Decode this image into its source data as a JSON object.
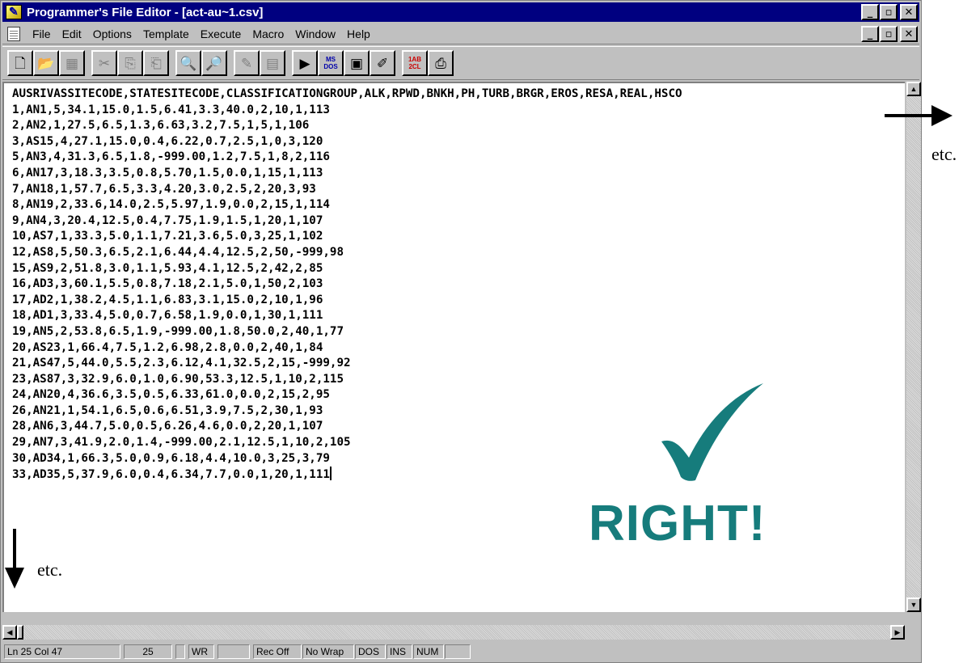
{
  "window": {
    "title": "Programmer's File Editor - [act-au~1.csv]",
    "min_glyph": "_",
    "max_glyph": "▫",
    "close_glyph": "✕"
  },
  "menu": {
    "items": [
      "File",
      "Edit",
      "Options",
      "Template",
      "Execute",
      "Macro",
      "Window",
      "Help"
    ],
    "underlined": [
      "F",
      "E",
      "O",
      "T",
      "x",
      "M",
      "W",
      "H"
    ]
  },
  "toolbar": {
    "buttons": [
      {
        "name": "new-file-icon",
        "glyph": "🗋",
        "enabled": true
      },
      {
        "name": "open-folder-icon",
        "glyph": "📂",
        "enabled": true
      },
      {
        "name": "save-icon",
        "glyph": "▦",
        "enabled": false
      },
      {
        "name": "cut-icon",
        "glyph": "✂",
        "enabled": false
      },
      {
        "name": "copy-icon",
        "glyph": "⎘",
        "enabled": false
      },
      {
        "name": "paste-icon",
        "glyph": "⎗",
        "enabled": false
      },
      {
        "name": "find-icon",
        "glyph": "🔍",
        "enabled": true
      },
      {
        "name": "find-next-icon",
        "glyph": "🔎",
        "enabled": true
      },
      {
        "name": "edit-pen-icon",
        "glyph": "✎",
        "enabled": false
      },
      {
        "name": "document-icon",
        "glyph": "▤",
        "enabled": false
      },
      {
        "name": "execute-icon",
        "glyph": "▶",
        "enabled": true
      },
      {
        "name": "ms-dos-icon",
        "label": "MS DOS",
        "enabled": true
      },
      {
        "name": "window-icon",
        "glyph": "▣",
        "enabled": true
      },
      {
        "name": "tool-icon",
        "glyph": "✐",
        "enabled": true
      },
      {
        "name": "sort-icon",
        "label": "1AB 2CL",
        "enabled": true
      },
      {
        "name": "print-icon",
        "glyph": "⎙",
        "enabled": true
      }
    ]
  },
  "editor": {
    "lines": [
      "AUSRIVASSITECODE,STATESITECODE,CLASSIFICATIONGROUP,ALK,RPWD,BNKH,PH,TURB,BRGR,EROS,RESA,REAL,HSCO",
      "1,AN1,5,34.1,15.0,1.5,6.41,3.3,40.0,2,10,1,113",
      "2,AN2,1,27.5,6.5,1.3,6.63,3.2,7.5,1,5,1,106",
      "3,AS15,4,27.1,15.0,0.4,6.22,0.7,2.5,1,0,3,120",
      "5,AN3,4,31.3,6.5,1.8,-999.00,1.2,7.5,1,8,2,116",
      "6,AN17,3,18.3,3.5,0.8,5.70,1.5,0.0,1,15,1,113",
      "7,AN18,1,57.7,6.5,3.3,4.20,3.0,2.5,2,20,3,93",
      "8,AN19,2,33.6,14.0,2.5,5.97,1.9,0.0,2,15,1,114",
      "9,AN4,3,20.4,12.5,0.4,7.75,1.9,1.5,1,20,1,107",
      "10,AS7,1,33.3,5.0,1.1,7.21,3.6,5.0,3,25,1,102",
      "12,AS8,5,50.3,6.5,2.1,6.44,4.4,12.5,2,50,-999,98",
      "15,AS9,2,51.8,3.0,1.1,5.93,4.1,12.5,2,42,2,85",
      "16,AD3,3,60.1,5.5,0.8,7.18,2.1,5.0,1,50,2,103",
      "17,AD2,1,38.2,4.5,1.1,6.83,3.1,15.0,2,10,1,96",
      "18,AD1,3,33.4,5.0,0.7,6.58,1.9,0.0,1,30,1,111",
      "19,AN5,2,53.8,6.5,1.9,-999.00,1.8,50.0,2,40,1,77",
      "20,AS23,1,66.4,7.5,1.2,6.98,2.8,0.0,2,40,1,84",
      "21,AS47,5,44.0,5.5,2.3,6.12,4.1,32.5,2,15,-999,92",
      "23,AS87,3,32.9,6.0,1.0,6.90,53.3,12.5,1,10,2,115",
      "24,AN20,4,36.6,3.5,0.5,6.33,61.0,0.0,2,15,2,95",
      "26,AN21,1,54.1,6.5,0.6,6.51,3.9,7.5,2,30,1,93",
      "28,AN6,3,44.7,5.0,0.5,6.26,4.6,0.0,2,20,1,107",
      "29,AN7,3,41.9,2.0,1.4,-999.00,2.1,12.5,1,10,2,105",
      "30,AD34,1,66.3,5.0,0.9,6.18,4.4,10.0,3,25,3,79",
      "33,AD35,5,37.9,6.0,0.4,6.34,7.7,0.0,1,20,1,111"
    ]
  },
  "statusbar": {
    "position": "Ln 25 Col 47",
    "line_count": "25",
    "mode": "WR",
    "rec": "Rec Off",
    "wrap": "No Wrap",
    "format": "DOS",
    "ins": "INS",
    "num": "NUM"
  },
  "annotations": {
    "right_etc": "etc.",
    "down_etc": "etc.",
    "verdict": "RIGHT!",
    "verdict_color": "#167c7c"
  }
}
